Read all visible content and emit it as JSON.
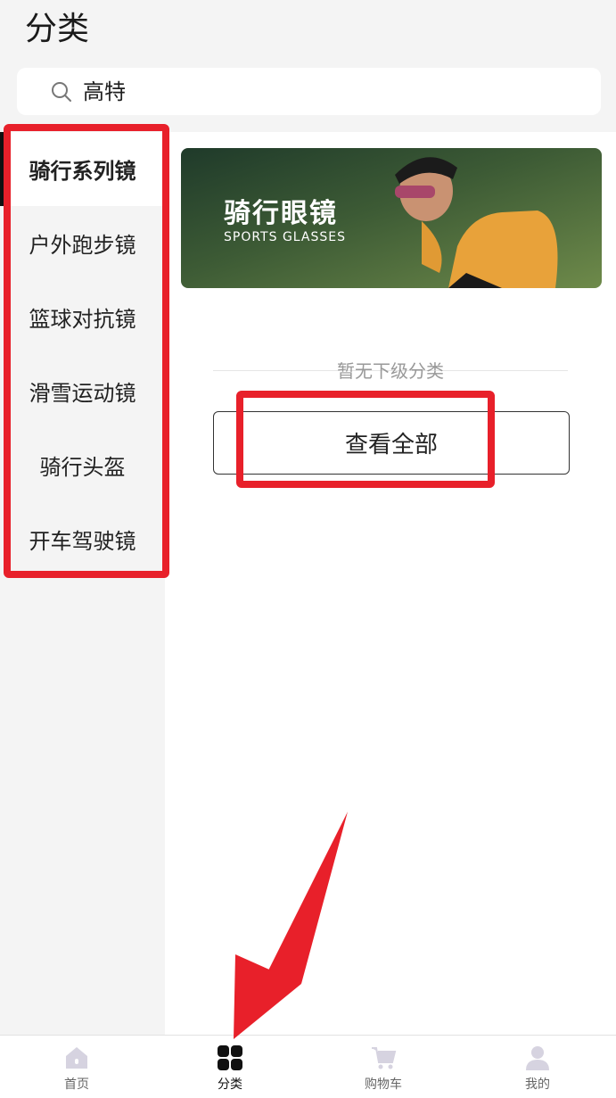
{
  "header": {
    "title": "分类"
  },
  "search": {
    "value": "高特",
    "icon": "search-icon"
  },
  "sidebar": {
    "items": [
      {
        "label": "骑行系列镜",
        "active": true
      },
      {
        "label": "户外跑步镜"
      },
      {
        "label": "篮球对抗镜"
      },
      {
        "label": "滑雪运动镜"
      },
      {
        "label": "骑行头盔"
      },
      {
        "label": "开车驾驶镜"
      }
    ]
  },
  "main": {
    "banner": {
      "title": "骑行眼镜",
      "subtitle": "SPORTS GLASSES"
    },
    "empty_text": "暂无下级分类",
    "view_all_label": "查看全部"
  },
  "tabbar": {
    "items": [
      {
        "label": "首页",
        "icon": "home-icon"
      },
      {
        "label": "分类",
        "icon": "category-icon",
        "active": true
      },
      {
        "label": "购物车",
        "icon": "cart-icon"
      },
      {
        "label": "我的",
        "icon": "user-icon"
      }
    ]
  },
  "colors": {
    "accent": "#111111",
    "annotation": "#e8202a",
    "tab_inactive_icon": "#d6d3e0"
  }
}
